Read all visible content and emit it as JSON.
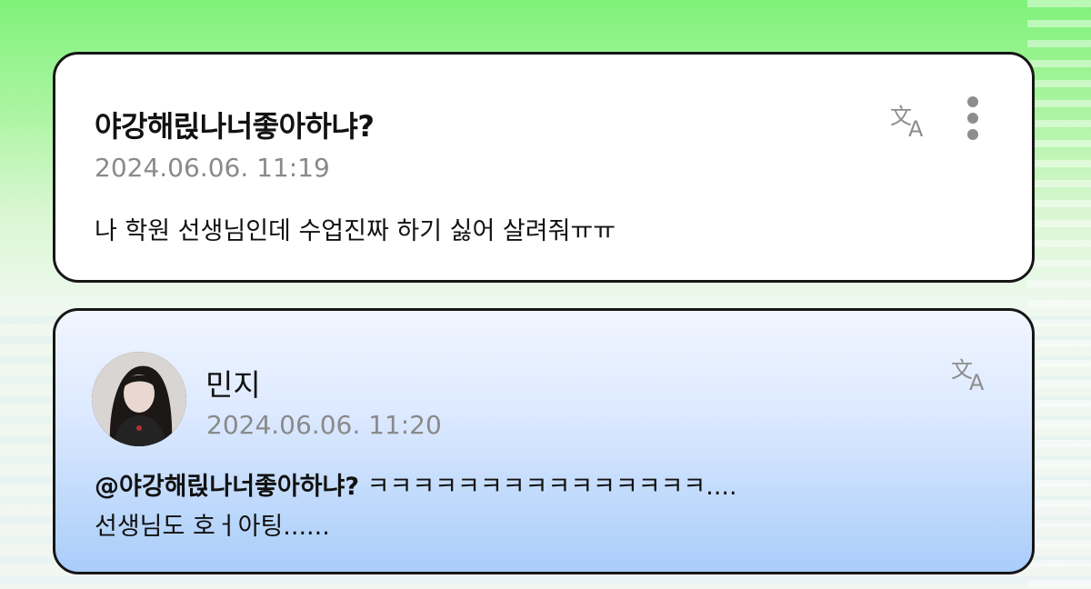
{
  "question": {
    "title": "야강해릱나너좋아하냐?",
    "timestamp": "2024.06.06. 11:19",
    "body": "나 학원 선생님인데 수업진짜 하기 싫어 살려줘ㅠㅠ",
    "icons": [
      "translate-icon",
      "more-vertical-icon"
    ]
  },
  "answer": {
    "author": "민지",
    "timestamp": "2024.06.06. 11:20",
    "mention": "@야강해릱나너좋아하냐?",
    "line1_rest": " ㅋㅋㅋㅋㅋㅋㅋㅋㅋㅋㅋㅋㅋㅋㅋ....",
    "line2": "선생님도 호ㅓ아팅......",
    "icons": [
      "translate-icon",
      "avatar"
    ]
  },
  "colors": {
    "background_top": "#7ff27a",
    "card_border": "#161616",
    "answer_card_bottom": "#a9cdf9",
    "timestamp": "#8a8a8a"
  }
}
